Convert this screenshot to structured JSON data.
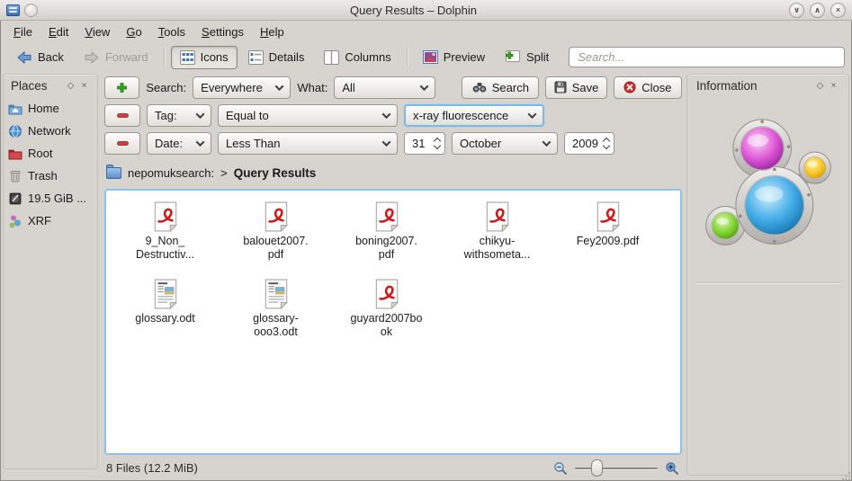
{
  "window": {
    "title": "Query Results – Dolphin"
  },
  "icons": {
    "minimize_glyph": "∨",
    "maximize_glyph": "∧",
    "close_glyph": "×",
    "float_glyph": "◇",
    "panel_close_glyph": "×"
  },
  "menubar": {
    "items": [
      {
        "key": "F",
        "rest": "ile"
      },
      {
        "key": "E",
        "rest": "dit"
      },
      {
        "key": "V",
        "rest": "iew"
      },
      {
        "key": "G",
        "rest": "o"
      },
      {
        "key": "T",
        "rest": "ools"
      },
      {
        "key": "S",
        "rest": "ettings"
      },
      {
        "key": "H",
        "rest": "elp"
      }
    ]
  },
  "toolbar": {
    "back_label": "Back",
    "forward_label": "Forward",
    "icons_label": "Icons",
    "details_label": "Details",
    "columns_label": "Columns",
    "preview_label": "Preview",
    "split_label": "Split",
    "search_placeholder": "Search..."
  },
  "search_panel": {
    "search_label": "Search:",
    "search_scope": "Everywhere",
    "what_label": "What:",
    "what_value": "All",
    "search_button": "Search",
    "save_button": "Save",
    "close_button": "Close",
    "tag_row": {
      "field": "Tag:",
      "operator": "Equal to",
      "value": "x-ray fluorescence"
    },
    "date_row": {
      "field": "Date:",
      "operator": "Less Than",
      "day": "31",
      "month": "October",
      "year": "2009"
    }
  },
  "breadcrumb": {
    "protocol": "nepomuksearch:",
    "separator": ">",
    "location": "Query Results"
  },
  "places": {
    "header": "Places",
    "items": [
      {
        "label": "Home",
        "icon": "home-folder-icon"
      },
      {
        "label": "Network",
        "icon": "network-globe-icon"
      },
      {
        "label": "Root",
        "icon": "root-folder-icon"
      },
      {
        "label": "Trash",
        "icon": "trash-icon"
      },
      {
        "label": "19.5 GiB ...",
        "icon": "hard-disk-icon"
      },
      {
        "label": "XRF",
        "icon": "nepomuk-tag-icon"
      }
    ]
  },
  "information": {
    "header": "Information"
  },
  "files": [
    {
      "name": "9_Non_\nDestructiv...",
      "type": "pdf"
    },
    {
      "name": "balouet2007.\npdf",
      "type": "pdf"
    },
    {
      "name": "boning2007.\npdf",
      "type": "pdf"
    },
    {
      "name": "chikyu-\nwithsometa...",
      "type": "pdf"
    },
    {
      "name": "Fey2009.pdf",
      "type": "pdf"
    },
    {
      "name": "glossary.odt",
      "type": "odt"
    },
    {
      "name": "glossary-\nooo3.odt",
      "type": "odt"
    },
    {
      "name": "guyard2007bo\nok",
      "type": "pdf"
    }
  ],
  "statusbar": {
    "text": "8 Files (12.2 MiB)"
  },
  "colors": {
    "view_border": "#8fc2e6",
    "pdf_red": "#cf1818",
    "plus_green": "#35a322",
    "minus_red": "#cf3b3b",
    "highlight_blue": "#7db9e2"
  }
}
